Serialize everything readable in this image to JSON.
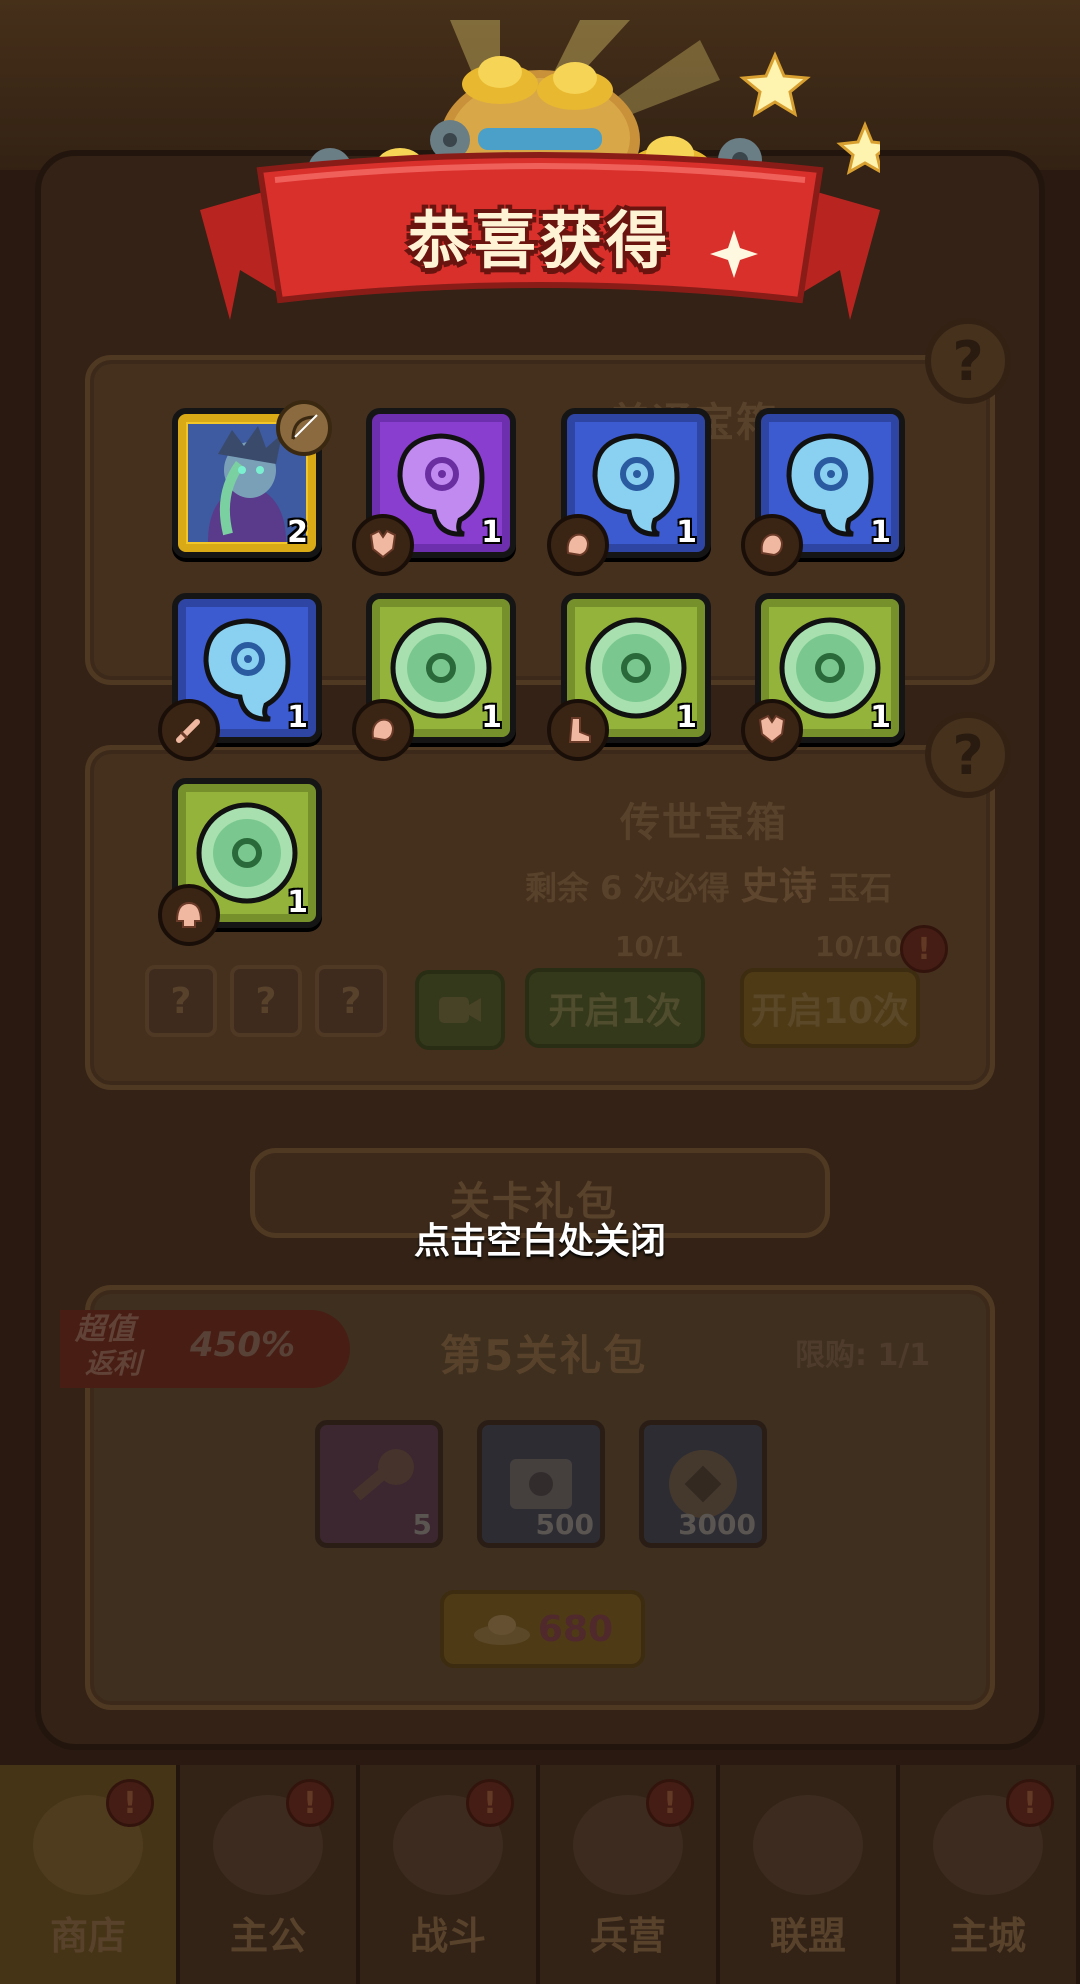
{
  "popup": {
    "title": "恭喜获得",
    "close_hint": "点击空白处关闭",
    "items": [
      {
        "type": "hero",
        "rarity": "gold",
        "qty": "2",
        "slot_icon": "bow-icon"
      },
      {
        "type": "jade-magatama",
        "rarity": "purple",
        "qty": "1",
        "slot_icon": "armor-icon"
      },
      {
        "type": "jade-magatama",
        "rarity": "blue",
        "qty": "1",
        "slot_icon": "glove-icon"
      },
      {
        "type": "jade-magatama",
        "rarity": "blue",
        "qty": "1",
        "slot_icon": "glove-icon"
      },
      {
        "type": "jade-magatama",
        "rarity": "blue",
        "qty": "1",
        "slot_icon": "sword-icon"
      },
      {
        "type": "jade-disc",
        "rarity": "green",
        "qty": "1",
        "slot_icon": "glove-icon"
      },
      {
        "type": "jade-disc",
        "rarity": "green",
        "qty": "1",
        "slot_icon": "boot-icon"
      },
      {
        "type": "jade-disc",
        "rarity": "green",
        "qty": "1",
        "slot_icon": "armor-icon"
      },
      {
        "type": "jade-disc",
        "rarity": "green",
        "qty": "1",
        "slot_icon": "helmet-icon"
      }
    ]
  },
  "shop": {
    "chest1": {
      "title": "普通宝箱"
    },
    "chest2": {
      "title": "传世宝箱",
      "guarantee_prefix": "剩余",
      "guarantee_count": "6",
      "guarantee_mid": "次必得",
      "guarantee_rarity": "史诗",
      "guarantee_item": "玉石",
      "key_count_1": "10/1",
      "key_count_10": "10/10",
      "open1_label": "开启1次",
      "open10_label": "开启10次",
      "alert": "!"
    },
    "stage_pack": {
      "section_title": "关卡礼包",
      "badge_line1": "超值",
      "badge_line2": "返利",
      "badge_percent": "450%",
      "title": "第5关礼包",
      "limit": "限购: 1/1",
      "rewards": [
        {
          "icon": "key-icon",
          "count": "5"
        },
        {
          "icon": "scroll-icon",
          "count": "500"
        },
        {
          "icon": "coin-icon",
          "count": "3000"
        }
      ],
      "price": "680"
    }
  },
  "nav": {
    "tabs": [
      {
        "label": "商店",
        "icon": "shop-icon",
        "active": true
      },
      {
        "label": "主公",
        "icon": "lord-icon",
        "active": false
      },
      {
        "label": "战斗",
        "icon": "battle-icon",
        "active": false
      },
      {
        "label": "兵营",
        "icon": "barracks-icon",
        "active": false
      },
      {
        "label": "联盟",
        "icon": "alliance-icon",
        "active": false
      },
      {
        "label": "主城",
        "icon": "city-icon",
        "active": false
      }
    ],
    "alert": "!"
  },
  "colors": {
    "ribbon_red": "#d9302c",
    "ribbon_text": "#fff3d6",
    "purple": "#8a3ed0",
    "blue": "#3c5bd0",
    "green": "#93b33a",
    "gold": "#f2c528"
  }
}
